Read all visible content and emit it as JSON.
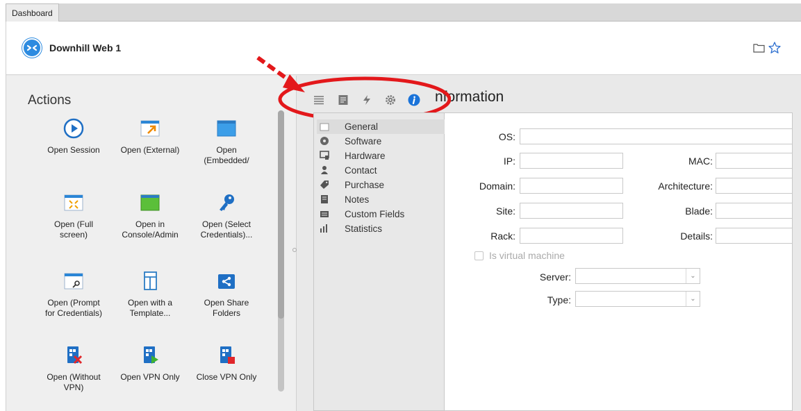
{
  "tabs": [
    {
      "label": "Dashboard"
    }
  ],
  "header": {
    "entry_title": "Downhill Web 1",
    "entry_icon": "remote-desktop-icon",
    "right_icons": [
      "folder-icon",
      "star-icon"
    ]
  },
  "actions": {
    "title": "Actions",
    "items": [
      {
        "label": "Open Session",
        "icon": "play-circle-icon"
      },
      {
        "label": "Open (External)",
        "icon": "open-external-icon"
      },
      {
        "label": "Open\n(Embedded/",
        "icon": "open-embedded-icon"
      },
      {
        "label": "Open (Full\nscreen)",
        "icon": "fullscreen-icon"
      },
      {
        "label": "Open in\nConsole/Admin",
        "icon": "console-window-icon"
      },
      {
        "label": "Open (Select\nCredentials)...",
        "icon": "key-icon"
      },
      {
        "label": "Open (Prompt\nfor Credentials)",
        "icon": "prompt-credentials-icon"
      },
      {
        "label": "Open with a\nTemplate...",
        "icon": "template-icon"
      },
      {
        "label": "Open Share\nFolders",
        "icon": "share-folder-icon"
      },
      {
        "label": "Open (Without\nVPN)",
        "icon": "open-without-vpn-icon"
      },
      {
        "label": "Open VPN Only",
        "icon": "open-vpn-icon"
      },
      {
        "label": "Close VPN Only",
        "icon": "close-vpn-icon"
      }
    ]
  },
  "toolbar": {
    "icons": [
      "list-icon",
      "notes-icon",
      "macro-icon",
      "settings-gear-icon",
      "information-icon"
    ],
    "section_title": "nformation"
  },
  "info_nav": {
    "items": [
      {
        "label": "General",
        "icon": "general-icon",
        "selected": true
      },
      {
        "label": "Software",
        "icon": "disc-icon"
      },
      {
        "label": "Hardware",
        "icon": "hardware-icon"
      },
      {
        "label": "Contact",
        "icon": "contact-icon"
      },
      {
        "label": "Purchase",
        "icon": "tag-icon"
      },
      {
        "label": "Notes",
        "icon": "note-icon"
      },
      {
        "label": "Custom Fields",
        "icon": "custom-fields-icon"
      },
      {
        "label": "Statistics",
        "icon": "bar-chart-icon"
      }
    ]
  },
  "form": {
    "os_label": "OS:",
    "os_value": "",
    "ip_label": "IP:",
    "ip_value": "",
    "mac_label": "MAC:",
    "mac_value": "",
    "domain_label": "Domain:",
    "domain_value": "",
    "architecture_label": "Architecture:",
    "architecture_value": "",
    "site_label": "Site:",
    "site_value": "",
    "blade_label": "Blade:",
    "blade_value": "",
    "rack_label": "Rack:",
    "rack_value": "",
    "details_label": "Details:",
    "details_value": "",
    "virtual_machine_label": "Is virtual machine",
    "virtual_machine_checked": false,
    "server_label": "Server:",
    "server_value": "",
    "type_label": "Type:",
    "type_value": ""
  },
  "colors": {
    "accent": "#2d8be0",
    "annotation": "#e3181b"
  }
}
